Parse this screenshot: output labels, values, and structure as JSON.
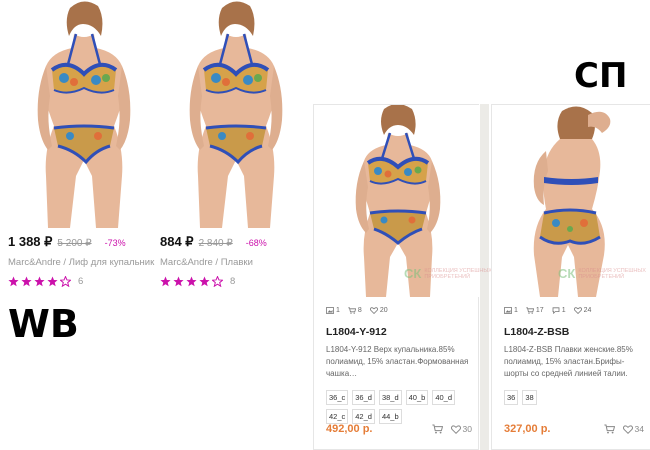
{
  "labels": {
    "wb": "WB",
    "sp": "СП"
  },
  "wb_products": [
    {
      "price": "1 388 ₽",
      "old_price": "5 200 ₽",
      "discount": "-73%",
      "title": "Marc&Andre / Лиф для купальник",
      "rating": 4,
      "reviews": "6"
    },
    {
      "price": "884 ₽",
      "old_price": "2 840 ₽",
      "discount": "-68%",
      "title": "Marc&Andre / Плавки",
      "rating": 4,
      "reviews": "8"
    }
  ],
  "sp_products": [
    {
      "stats": {
        "photos": "1",
        "orders": "8",
        "comments": "",
        "likes": "20"
      },
      "sku": "L1804-Y-912",
      "description": "L1804-Y-912 Верх купальника.85% полиамид, 15% эластан.Формованная чашка…",
      "sizes": [
        "36_c",
        "36_d",
        "38_d",
        "40_b",
        "40_d",
        "42_c",
        "42_d",
        "44_b"
      ],
      "price": "492,00 р.",
      "likes": "30"
    },
    {
      "stats": {
        "photos": "1",
        "orders": "17",
        "comments": "1",
        "likes": "24"
      },
      "sku": "L1804-Z-BSB",
      "description": "L1804-Z-BSB Плавки женские.85% полиамид, 15% эластан.Брифы-шорты со средней линией талии. Н…",
      "sizes": [
        "36",
        "38"
      ],
      "price": "327,00 р.",
      "likes": "34"
    }
  ],
  "watermark": {
    "logo": "СК",
    "text": "КОЛЛЕКЦИЯ УСПЕШНЫХ ПРИОБРЕТЕНИЙ"
  },
  "icons": {
    "rating_star": "star-icon",
    "cart": "cart-icon",
    "heart": "heart-icon",
    "photo": "photo-icon",
    "comment": "comment-icon"
  },
  "colors": {
    "wb_accent": "#cb11ab",
    "sp_price": "#e57d38",
    "swimsuit_blue": "#2f4fb8"
  }
}
